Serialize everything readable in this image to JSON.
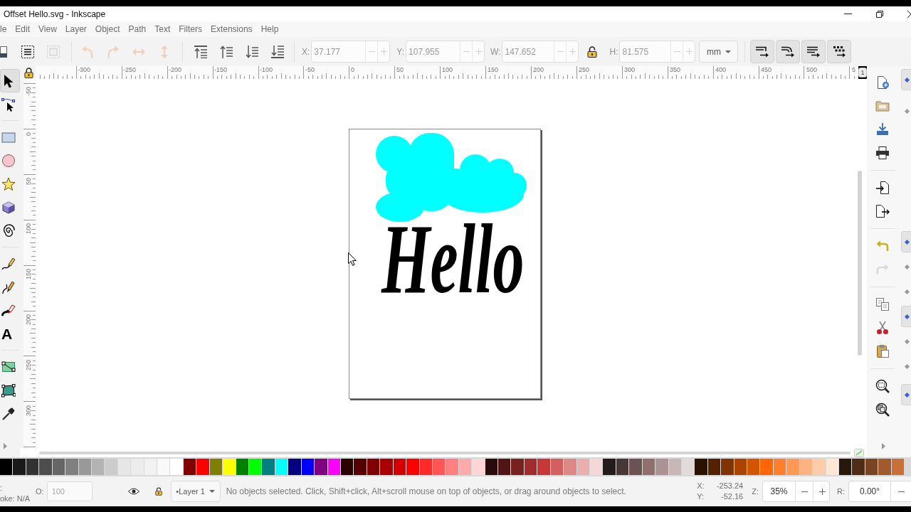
{
  "window": {
    "title": "Offset Hello.svg - Inkscape"
  },
  "menu": [
    "le",
    "Edit",
    "View",
    "Layer",
    "Object",
    "Path",
    "Text",
    "Filters",
    "Extensions",
    "Help"
  ],
  "toolbar": {
    "buttons": [
      [
        {
          "kind": "document",
          "disabled": false
        }
      ],
      [
        {
          "kind": "select-all",
          "disabled": false
        },
        {
          "kind": "select-all-layers",
          "disabled": true
        }
      ],
      [
        {
          "kind": "rotate-ccw",
          "disabled": true
        },
        {
          "kind": "rotate-cw",
          "disabled": true
        },
        {
          "kind": "flip-horizontal",
          "disabled": true
        },
        {
          "kind": "flip-vertical",
          "disabled": true
        }
      ],
      [
        {
          "kind": "raise-top",
          "disabled": false
        },
        {
          "kind": "raise",
          "disabled": false
        },
        {
          "kind": "lower",
          "disabled": false
        },
        {
          "kind": "lower-bottom",
          "disabled": false
        }
      ]
    ],
    "fields": [
      {
        "label": "X:",
        "value": "37.177",
        "disabled": true
      },
      {
        "label": "Y:",
        "value": "107.955",
        "disabled": true
      },
      {
        "label": "W:",
        "value": "147.652",
        "disabled": true
      },
      {
        "label": "H:",
        "value": "81.575",
        "disabled": true
      }
    ],
    "lock": {
      "locked": false
    },
    "unit": "mm",
    "toggles": [
      {
        "kind": "scale-stroke",
        "on": true
      },
      {
        "kind": "scale-corners",
        "on": true
      },
      {
        "kind": "move-gradients",
        "on": true
      },
      {
        "kind": "move-patterns",
        "on": true
      }
    ]
  },
  "rulers": {
    "horizontal": [
      "-300",
      "-250",
      "-200",
      "-150",
      "-100",
      "-50",
      "0",
      "50",
      "100",
      "150",
      "200",
      "250",
      "300",
      "350",
      "400",
      "450",
      "500",
      "5"
    ],
    "vertical": [
      "-50",
      "0",
      "50",
      "100",
      "150",
      "200",
      "250",
      "300"
    ]
  },
  "corner_button": "1",
  "toolbox": [
    [
      {
        "kind": "selector",
        "selected": true
      },
      {
        "kind": "node",
        "selected": false
      }
    ],
    [
      {
        "kind": "rect",
        "selected": false
      },
      {
        "kind": "ellipse",
        "selected": false
      },
      {
        "kind": "star",
        "selected": false
      },
      {
        "kind": "box3d",
        "selected": false
      },
      {
        "kind": "spiral",
        "selected": false
      }
    ],
    [
      {
        "kind": "pencil",
        "selected": false
      },
      {
        "kind": "pen",
        "selected": false
      },
      {
        "kind": "calligraphy",
        "selected": false
      },
      {
        "kind": "text",
        "glyph": "A",
        "selected": false
      }
    ],
    [
      {
        "kind": "gradient",
        "selected": false
      },
      {
        "kind": "mesh",
        "selected": false
      },
      {
        "kind": "dropper",
        "selected": false
      }
    ]
  ],
  "canvas": {
    "text": "Hello"
  },
  "commands": [
    [
      {
        "kind": "new",
        "disabled": false
      },
      {
        "kind": "open",
        "disabled": false
      },
      {
        "kind": "save",
        "disabled": false
      },
      {
        "kind": "print",
        "disabled": false
      }
    ],
    [
      {
        "kind": "import",
        "disabled": false
      },
      {
        "kind": "export",
        "disabled": false
      }
    ],
    [
      {
        "kind": "undo",
        "disabled": false
      },
      {
        "kind": "redo",
        "disabled": true
      }
    ],
    [
      {
        "kind": "copy",
        "disabled": false
      },
      {
        "kind": "cut",
        "disabled": false
      },
      {
        "kind": "paste",
        "disabled": false
      }
    ],
    [
      {
        "kind": "zoom-selection",
        "disabled": false
      },
      {
        "kind": "zoom-drawing",
        "disabled": false
      }
    ]
  ],
  "snap_bar": [
    [
      {
        "on": true
      },
      {
        "on": false
      }
    ],
    [
      {
        "on": true
      },
      {
        "on": false
      },
      {
        "on": false
      },
      {
        "on": true
      },
      {
        "on": false
      },
      {
        "on": false
      }
    ],
    [
      {
        "on": true
      }
    ]
  ],
  "palette": [
    {
      "color": "#000000"
    },
    {
      "color": "#1a1a1a"
    },
    {
      "color": "#333333"
    },
    {
      "color": "#4d4d4d"
    },
    {
      "color": "#666666"
    },
    {
      "color": "#808080"
    },
    {
      "color": "#999999"
    },
    {
      "color": "#b3b3b3"
    },
    {
      "color": "#cccccc"
    },
    {
      "color": "#e6e6e6"
    },
    {
      "color": "#ececec"
    },
    {
      "color": "#f2f2f2"
    },
    {
      "color": "#f9f9f9"
    },
    {
      "color": "#ffffff"
    },
    {
      "color": "#800000"
    },
    {
      "color": "#ff0000"
    },
    {
      "color": "#808000"
    },
    {
      "color": "#ffff00"
    },
    {
      "color": "#008000"
    },
    {
      "color": "#00ff00"
    },
    {
      "color": "#008080"
    },
    {
      "color": "#00ffff"
    },
    {
      "color": "#000080"
    },
    {
      "color": "#0000ff"
    },
    {
      "color": "#800080"
    },
    {
      "color": "#ff00ff"
    },
    {
      "color": "#2b0000"
    },
    {
      "color": "#550000"
    },
    {
      "color": "#800000"
    },
    {
      "color": "#aa0000"
    },
    {
      "color": "#d40000"
    },
    {
      "color": "#ff0000"
    },
    {
      "color": "#ff2a2a"
    },
    {
      "color": "#ff5555"
    },
    {
      "color": "#ff8080"
    },
    {
      "color": "#ffaaaa"
    },
    {
      "color": "#ffd5d5"
    },
    {
      "color": "#280b0b"
    },
    {
      "color": "#501616"
    },
    {
      "color": "#782121"
    },
    {
      "color": "#a02c2c"
    },
    {
      "color": "#c83737"
    },
    {
      "color": "#d35f5f"
    },
    {
      "color": "#de8787"
    },
    {
      "color": "#e9afaf"
    },
    {
      "color": "#f4d7d7"
    },
    {
      "color": "#241c1c"
    },
    {
      "color": "#483737"
    },
    {
      "color": "#6c5353"
    },
    {
      "color": "#916f6f"
    },
    {
      "color": "#ac9393"
    },
    {
      "color": "#c8b7b7"
    },
    {
      "color": "#e3dbdb"
    },
    {
      "color": "#2b1100"
    },
    {
      "color": "#552200"
    },
    {
      "color": "#803300"
    },
    {
      "color": "#aa4400"
    },
    {
      "color": "#d45500"
    },
    {
      "color": "#ff6600"
    },
    {
      "color": "#ff7f2a"
    },
    {
      "color": "#ff9955"
    },
    {
      "color": "#ffb380"
    },
    {
      "color": "#ffccaa"
    },
    {
      "color": "#ffe6d5"
    },
    {
      "color": "#28170b"
    },
    {
      "color": "#502d16"
    },
    {
      "color": "#784421"
    },
    {
      "color": "#a05a2c"
    },
    {
      "color": "#c87137"
    }
  ],
  "status_bar": {
    "fill_label": ":",
    "stroke": "oke: N/A",
    "opacity_label": "O:",
    "opacity": "100",
    "layer_visible": true,
    "layer_locked": false,
    "layer": "•Layer 1",
    "message": "No objects selected. Click, Shift+click, Alt+scroll mouse on top of objects, or drag around objects to select.",
    "cursor": [
      {
        "label": "X:",
        "value": "-253.24"
      },
      {
        "label": "Y:",
        "value": "-52.16"
      }
    ],
    "zoom_label": "Z:",
    "zoom": "35%",
    "rotation_label": "R:",
    "rotation": "0.00°"
  }
}
